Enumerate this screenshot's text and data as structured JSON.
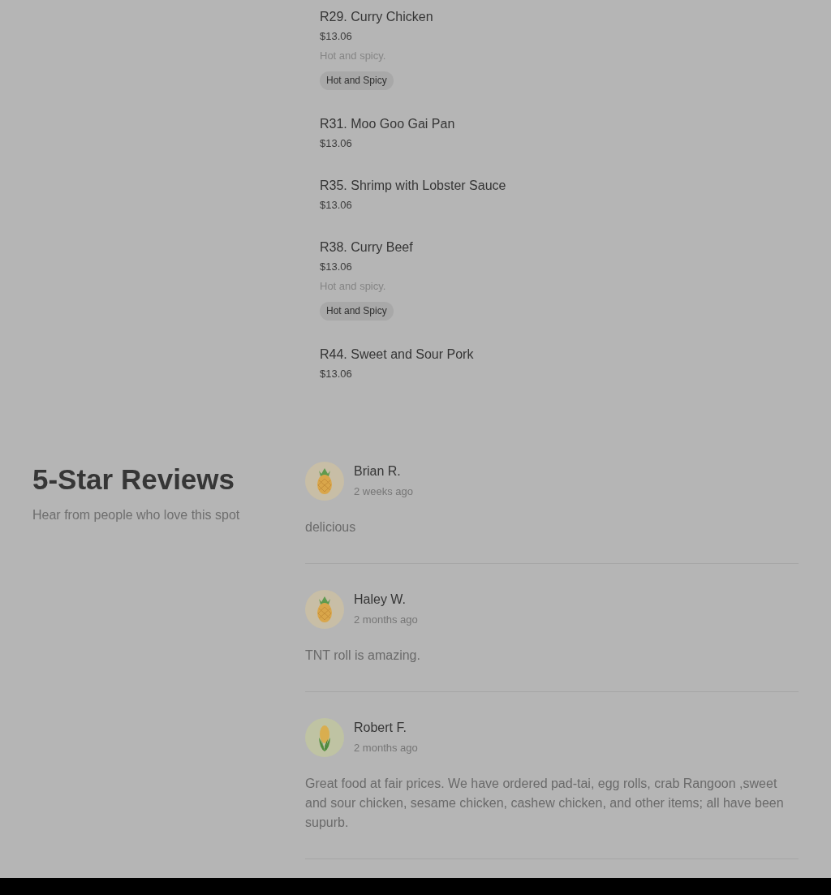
{
  "menu_items": [
    {
      "name": "R29. Curry Chicken",
      "price": "$13.06",
      "description": "Hot and spicy.",
      "tags": [
        "Hot and Spicy"
      ]
    },
    {
      "name": "R31. Moo Goo Gai Pan",
      "price": "$13.06"
    },
    {
      "name": "R35. Shrimp with Lobster Sauce",
      "price": "$13.06"
    },
    {
      "name": "R38. Curry Beef",
      "price": "$13.06",
      "description": "Hot and spicy.",
      "tags": [
        "Hot and Spicy"
      ]
    },
    {
      "name": "R44. Sweet and Sour Pork",
      "price": "$13.06"
    }
  ],
  "reviews_section": {
    "title": "5-Star Reviews",
    "subtitle": "Hear from people who love this spot"
  },
  "reviews": [
    {
      "author": "Brian R.",
      "time": "2 weeks ago",
      "kind": "pineapple",
      "text": "delicious"
    },
    {
      "author": "Haley W.",
      "time": "2 months ago",
      "kind": "pineapple",
      "text": "TNT roll is amazing."
    },
    {
      "author": "Robert F.",
      "time": "2 months ago",
      "kind": "corn",
      "text": "Great food at fair prices. We have ordered pad-tai, egg rolls, crab Rangoon ,sweet and sour chicken, sesame chicken, cashew chicken, and other items; all have been supurb."
    }
  ]
}
